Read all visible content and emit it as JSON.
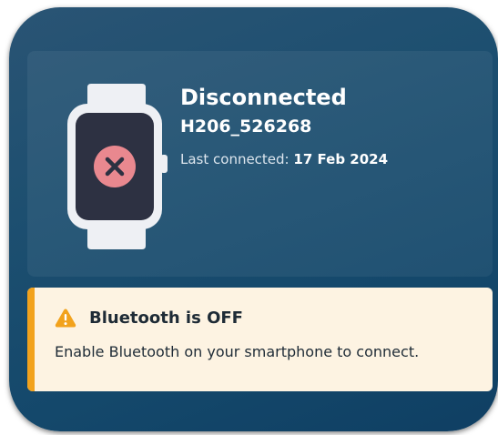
{
  "device": {
    "status": "Disconnected",
    "id": "H206_526268",
    "last_connected_label": "Last connected:",
    "last_connected_date": "17 Feb 2024",
    "icon": "smartwatch-icon",
    "status_icon": "close-icon",
    "status_color": "#e9888f"
  },
  "alert": {
    "icon": "warning-icon",
    "title": "Bluetooth is OFF",
    "message": "Enable Bluetooth on your smartphone to connect.",
    "accent_color": "#f2a21c",
    "background_color": "#fdf3e2"
  }
}
